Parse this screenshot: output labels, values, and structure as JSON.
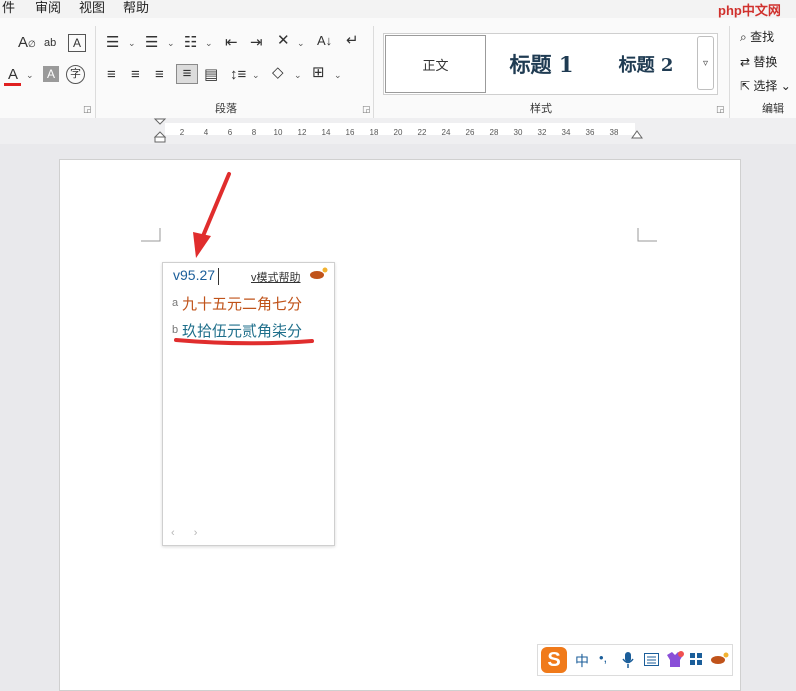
{
  "menu": {
    "items": [
      "件",
      "审阅",
      "视图",
      "帮助"
    ]
  },
  "watermark": "php中文网",
  "ribbon": {
    "font_group": {
      "icons": [
        "clear-format-icon",
        "phonetic-guide-icon",
        "character-border-icon",
        "font-color-icon",
        "character-shading-icon",
        "enclosed-character-icon"
      ]
    },
    "paragraph_group": {
      "label": "段落",
      "icons": [
        "bullets-icon",
        "numbering-icon",
        "multilevel-list-icon",
        "decrease-indent-icon",
        "increase-indent-icon",
        "chinese-layout-icon",
        "sort-icon",
        "show-marks-icon",
        "align-left-icon",
        "center-icon",
        "align-right-icon",
        "justify-icon",
        "distributed-icon",
        "line-spacing-icon",
        "shading-icon",
        "borders-icon"
      ]
    },
    "styles_group": {
      "label": "样式",
      "normal": "正文",
      "heading1": "标题 1",
      "heading2": "标题 2"
    },
    "editing_group": {
      "label": "编辑",
      "find": "查找",
      "replace": "替换",
      "select": "选择"
    }
  },
  "ruler": {
    "ticks": [
      "2",
      "4",
      "6",
      "8",
      "10",
      "12",
      "14",
      "16",
      "18",
      "20",
      "22",
      "24",
      "26",
      "28",
      "30",
      "32",
      "34",
      "36",
      "38"
    ]
  },
  "ime": {
    "input": "v95.27",
    "help": "v模式帮助",
    "candidates": [
      {
        "index": "a",
        "text": "九十五元二角七分",
        "color": "#c0531a"
      },
      {
        "index": "b",
        "text": "玖拾伍元贰角柒分",
        "color": "#1f6f8b"
      }
    ],
    "nav": "‹ ›"
  },
  "status_bar": {
    "logo": "S",
    "mode": "中",
    "icons": [
      "punctuation-icon",
      "microphone-icon",
      "keyboard-icon",
      "skin-icon",
      "toolbox-icon",
      "gamepad-icon"
    ]
  },
  "colors": {
    "annotation": "#e02d2d",
    "font_color_bar": "#e02020"
  }
}
